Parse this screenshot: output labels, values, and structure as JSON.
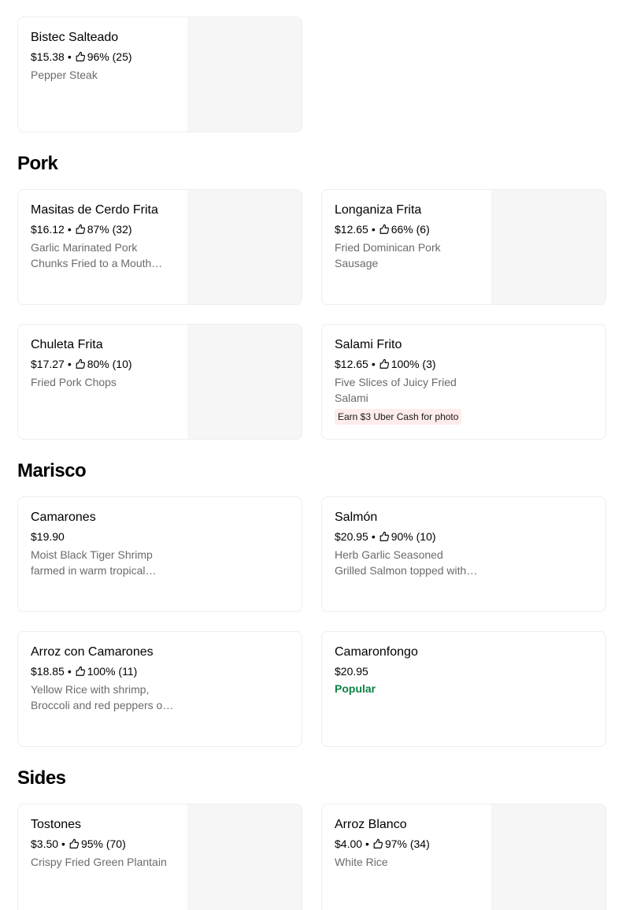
{
  "items": {
    "bistec": {
      "name": "Bistec Salteado",
      "price": "$15.38",
      "rating": "96% (25)",
      "desc": "Pepper Steak"
    },
    "masitas": {
      "name": "Masitas de Cerdo Frita",
      "price": "$16.12",
      "rating": "87% (32)",
      "desc": "Garlic Marinated Pork Chunks Fried to a Mouth Watering Crisp"
    },
    "longaniza": {
      "name": "Longaniza Frita",
      "price": "$12.65",
      "rating": "66% (6)",
      "desc": "Fried Dominican Pork Sausage"
    },
    "chuleta": {
      "name": "Chuleta Frita",
      "price": "$17.27",
      "rating": "80% (10)",
      "desc": "Fried Pork Chops"
    },
    "salami": {
      "name": "Salami Frito",
      "price": "$12.65",
      "rating": "100% (3)",
      "desc": "Five Slices of Juicy Fried Salami",
      "promo": "Earn $3 Uber Cash for photo"
    },
    "camarones": {
      "name": "Camarones",
      "price": "$19.90",
      "desc": "Moist Black Tiger Shrimp farmed in warm tropical waters"
    },
    "salmon": {
      "name": "Salmón",
      "price": "$20.95",
      "rating": "90% (10)",
      "desc": "Herb Garlic Seasoned Grilled Salmon topped with sauce"
    },
    "arroz_camarones": {
      "name": "Arroz con Camarones",
      "price": "$18.85",
      "rating": "100% (11)",
      "desc": "Yellow Rice with shrimp, Broccoli and red peppers on top"
    },
    "camaronfongo": {
      "name": "Camaronfongo",
      "price": "$20.95",
      "badge": "Popular"
    },
    "tostones": {
      "name": "Tostones",
      "price": "$3.50",
      "rating": "95% (70)",
      "desc": "Crispy Fried Green Plantain"
    },
    "arroz_blanco": {
      "name": "Arroz Blanco",
      "price": "$4.00",
      "rating": "97% (34)",
      "desc": "White Rice"
    }
  },
  "sections": {
    "pork": "Pork",
    "marisco": "Marisco",
    "sides": "Sides"
  },
  "separator": "•",
  "icons": {
    "rating": "thumbs-up-icon"
  },
  "colors": {
    "popular": "#0e8345",
    "promo_bg": "#fdeceb",
    "muted": "#6b6b6b",
    "image_placeholder": "#f6f6f6"
  }
}
